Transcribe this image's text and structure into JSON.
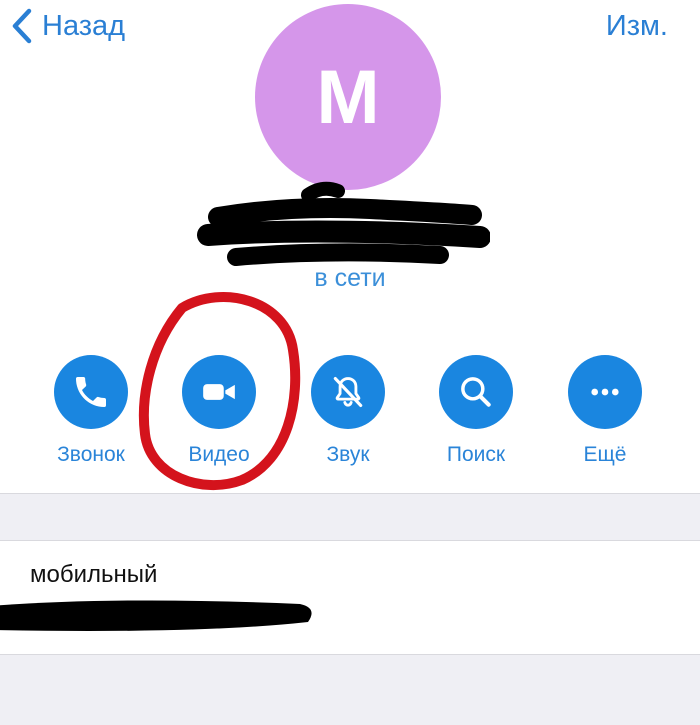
{
  "nav": {
    "back_label": "Назад",
    "edit_label": "Изм."
  },
  "profile": {
    "avatar_initial": "M",
    "avatar_color": "#d596ea",
    "status": "в сети"
  },
  "actions": [
    {
      "label": "Звонок",
      "icon": "phone-icon"
    },
    {
      "label": "Видео",
      "icon": "video-camera-icon"
    },
    {
      "label": "Звук",
      "icon": "bell-slash-icon"
    },
    {
      "label": "Поиск",
      "icon": "search-icon"
    },
    {
      "label": "Ещё",
      "icon": "ellipsis-icon"
    }
  ],
  "contact": {
    "phone_label": "мобильный"
  },
  "colors": {
    "accent": "#1a86e0",
    "highlight": "#d4131c"
  }
}
